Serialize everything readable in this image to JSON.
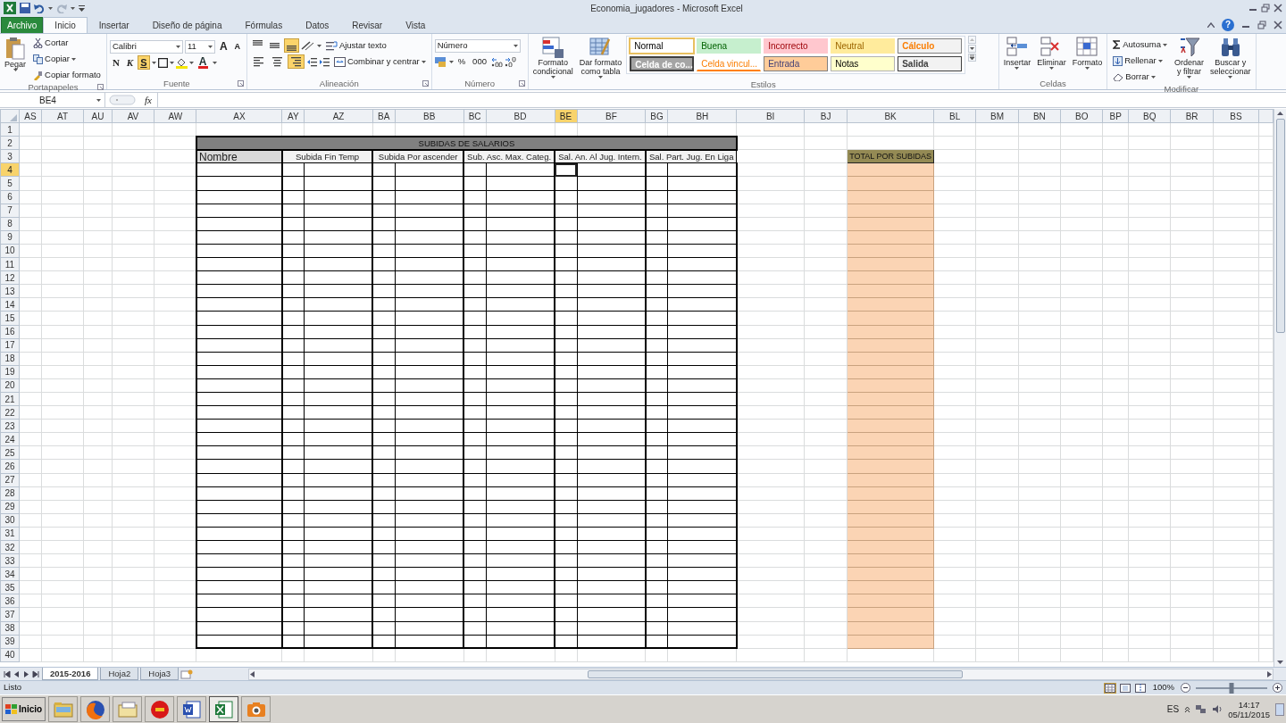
{
  "window": {
    "title": "Economia_jugadores - Microsoft Excel"
  },
  "ribbon_tabs": [
    {
      "label": "Archivo",
      "kind": "file",
      "selected": false
    },
    {
      "label": "Inicio",
      "kind": "tab",
      "selected": true
    },
    {
      "label": "Insertar",
      "kind": "tab",
      "selected": false
    },
    {
      "label": "Diseño de página",
      "kind": "tab",
      "selected": false
    },
    {
      "label": "Fórmulas",
      "kind": "tab",
      "selected": false
    },
    {
      "label": "Datos",
      "kind": "tab",
      "selected": false
    },
    {
      "label": "Revisar",
      "kind": "tab",
      "selected": false
    },
    {
      "label": "Vista",
      "kind": "tab",
      "selected": false
    }
  ],
  "help": "?",
  "clipboard": {
    "label": "Portapapeles",
    "paste": "Pegar",
    "cut": "Cortar",
    "copy": "Copiar",
    "format_painter": "Copiar formato"
  },
  "font": {
    "label": "Fuente",
    "name": "Calibri",
    "size": "11",
    "grow": "A",
    "shrink": "A",
    "bold": "N",
    "italic": "K",
    "underline": {
      "label": "S",
      "on": true
    },
    "color_button": "A"
  },
  "alignment": {
    "label": "Alineación",
    "vertical": [
      {
        "selected": false
      },
      {
        "selected": false
      },
      {
        "selected": true
      }
    ],
    "horizontal": [
      {
        "selected": false
      },
      {
        "selected": false
      },
      {
        "selected": true
      }
    ],
    "wrap": "Ajustar texto",
    "merge": "Combinar y centrar"
  },
  "number": {
    "label": "Número",
    "format": "Número",
    "percent": "%",
    "thousands": "000"
  },
  "styles": {
    "label": "Estilos",
    "conditional": [
      "Formato",
      "condicional"
    ],
    "as_table": [
      "Dar formato",
      "como tabla"
    ],
    "cells": [
      {
        "label": "Normal",
        "kind": "normal",
        "selected": true
      },
      {
        "label": "Buena",
        "kind": "good",
        "selected": false
      },
      {
        "label": "Incorrecto",
        "kind": "bad",
        "selected": false
      },
      {
        "label": "Neutral",
        "kind": "neutral",
        "selected": false
      },
      {
        "label": "Cálculo",
        "kind": "calc",
        "selected": false
      },
      {
        "label": "Celda de co...",
        "kind": "check",
        "selected": false
      },
      {
        "label": "Celda vincul...",
        "kind": "linked",
        "selected": false
      },
      {
        "label": "Entrada",
        "kind": "input",
        "selected": false
      },
      {
        "label": "Notas",
        "kind": "note",
        "selected": false
      },
      {
        "label": "Salida",
        "kind": "output",
        "selected": false
      }
    ]
  },
  "cells_group": {
    "label": "Celdas",
    "insert": "Insertar",
    "delete": "Eliminar",
    "format": "Formato"
  },
  "editing": {
    "label": "Modificar",
    "autosum": "Autosuma",
    "fill": "Rellenar",
    "clear": "Borrar",
    "sort": [
      "Ordenar",
      "y filtrar"
    ],
    "find": [
      "Buscar y",
      "seleccionar"
    ]
  },
  "formula_bar": {
    "name_box": "BE4",
    "fx": "fx"
  },
  "columns": [
    {
      "label": "AS",
      "selected": false
    },
    {
      "label": "AT",
      "selected": false
    },
    {
      "label": "AU",
      "selected": false
    },
    {
      "label": "AV",
      "selected": false
    },
    {
      "label": "AW",
      "selected": false
    },
    {
      "label": "AX",
      "selected": false
    },
    {
      "label": "AY",
      "selected": false
    },
    {
      "label": "AZ",
      "selected": false
    },
    {
      "label": "BA",
      "selected": false
    },
    {
      "label": "BB",
      "selected": false
    },
    {
      "label": "BC",
      "selected": false
    },
    {
      "label": "BD",
      "selected": false
    },
    {
      "label": "BE",
      "selected": true
    },
    {
      "label": "BF",
      "selected": false
    },
    {
      "label": "BG",
      "selected": false
    },
    {
      "label": "BH",
      "selected": false
    },
    {
      "label": "BI",
      "selected": false
    },
    {
      "label": "BJ",
      "selected": false
    },
    {
      "label": "BK",
      "selected": false
    },
    {
      "label": "BL",
      "selected": false
    },
    {
      "label": "BM",
      "selected": false
    },
    {
      "label": "BN",
      "selected": false
    },
    {
      "label": "BO",
      "selected": false
    },
    {
      "label": "BP",
      "selected": false
    },
    {
      "label": "BQ",
      "selected": false
    },
    {
      "label": "BR",
      "selected": false
    },
    {
      "label": "BS",
      "selected": false
    }
  ],
  "rows": [
    {
      "label": "1",
      "selected": false
    },
    {
      "label": "2",
      "selected": false
    },
    {
      "label": "3",
      "selected": false
    },
    {
      "label": "4",
      "selected": true
    },
    {
      "label": "5",
      "selected": false
    },
    {
      "label": "6",
      "selected": false
    },
    {
      "label": "7",
      "selected": false
    },
    {
      "label": "8",
      "selected": false
    },
    {
      "label": "9",
      "selected": false
    },
    {
      "label": "10",
      "selected": false
    },
    {
      "label": "11",
      "selected": false
    },
    {
      "label": "12",
      "selected": false
    },
    {
      "label": "13",
      "selected": false
    },
    {
      "label": "14",
      "selected": false
    },
    {
      "label": "15",
      "selected": false
    },
    {
      "label": "16",
      "selected": false
    },
    {
      "label": "17",
      "selected": false
    },
    {
      "label": "18",
      "selected": false
    },
    {
      "label": "19",
      "selected": false
    },
    {
      "label": "20",
      "selected": false
    },
    {
      "label": "21",
      "selected": false
    },
    {
      "label": "22",
      "selected": false
    },
    {
      "label": "23",
      "selected": false
    },
    {
      "label": "24",
      "selected": false
    },
    {
      "label": "25",
      "selected": false
    },
    {
      "label": "26",
      "selected": false
    },
    {
      "label": "27",
      "selected": false
    },
    {
      "label": "28",
      "selected": false
    },
    {
      "label": "29",
      "selected": false
    },
    {
      "label": "30",
      "selected": false
    },
    {
      "label": "31",
      "selected": false
    },
    {
      "label": "32",
      "selected": false
    },
    {
      "label": "33",
      "selected": false
    },
    {
      "label": "34",
      "selected": false
    },
    {
      "label": "35",
      "selected": false
    },
    {
      "label": "36",
      "selected": false
    },
    {
      "label": "37",
      "selected": false
    },
    {
      "label": "38",
      "selected": false
    },
    {
      "label": "39",
      "selected": false
    },
    {
      "label": "40",
      "selected": false
    }
  ],
  "table": {
    "title": "SUBIDAS DE SALARIOS",
    "name_header": "Nombre",
    "groups": [
      "Subida Fin Temp",
      "Subida Por ascender",
      "Sub. Asc. Max. Categ.",
      "Sal. An. Al Jug. Intern.",
      "Sal. Part. Jug. En Liga"
    ]
  },
  "total": {
    "header": "TOTAL POR SUBIDAS"
  },
  "sheet_tabs": [
    {
      "label": "2015-2016",
      "selected": true
    },
    {
      "label": "Hoja2",
      "selected": false
    },
    {
      "label": "Hoja3",
      "selected": false
    }
  ],
  "status_bar": {
    "text": "Listo",
    "views": [
      {
        "kind": "normal",
        "selected": true
      },
      {
        "kind": "layout",
        "selected": false
      },
      {
        "kind": "pagebreak",
        "selected": false
      }
    ],
    "zoom": {
      "reading": "100%",
      "level": 0.5
    }
  },
  "taskbar": {
    "start": "Inicio",
    "apps": [
      {
        "kind": "explorer",
        "selected": false
      },
      {
        "kind": "browser",
        "selected": false
      },
      {
        "kind": "folder",
        "selected": false
      },
      {
        "kind": "media",
        "selected": false
      },
      {
        "kind": "word",
        "selected": false
      },
      {
        "kind": "excel",
        "selected": true
      },
      {
        "kind": "camera",
        "selected": false
      }
    ],
    "language": "ES",
    "time": "14:17",
    "date": "05/11/2015"
  }
}
